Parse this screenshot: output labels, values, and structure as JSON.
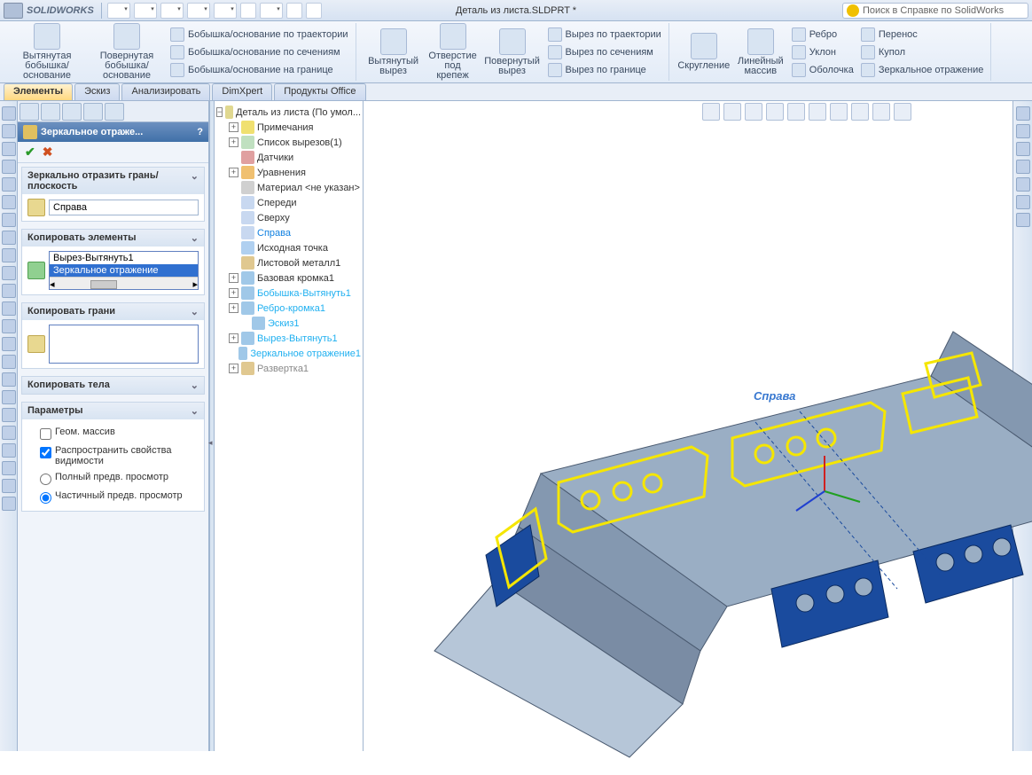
{
  "app": {
    "name": "SOLIDWORKS",
    "doc_title": "Деталь из листа.SLDPRT *"
  },
  "search": {
    "placeholder": "Поиск в Справке по SolidWorks"
  },
  "ribbon": {
    "extruded_boss": "Вытянутая\nбобышка/основание",
    "revolved_boss": "Повернутая\nбобышка/основание",
    "swept_boss": "Бобышка/основание по траектории",
    "lofted_boss": "Бобышка/основание по сечениям",
    "boundary_boss": "Бобышка/основание на границе",
    "extruded_cut": "Вытянутый\nвырез",
    "hole_wizard": "Отверстие\nпод\nкрепеж",
    "revolved_cut": "Повернутый\nвырез",
    "swept_cut": "Вырез по траектории",
    "lofted_cut": "Вырез по сечениям",
    "boundary_cut": "Вырез по границе",
    "fillet": "Скругление",
    "linear_pattern": "Линейный\nмассив",
    "rib": "Ребро",
    "draft": "Уклон",
    "shell": "Оболочка",
    "wrap": "Перенос",
    "dome": "Купол",
    "mirror": "Зеркальное отражение"
  },
  "tabs": {
    "features": "Элементы",
    "sketch": "Эскиз",
    "evaluate": "Анализировать",
    "dimxpert": "DimXpert",
    "office": "Продукты Office"
  },
  "pm": {
    "title": "Зеркальное отраже...",
    "group_mirror": "Зеркально отразить грань/плоскость",
    "mirror_value": "Справа",
    "group_copy_elem": "Копировать элементы",
    "copy_item1": "Вырез-Вытянуть1",
    "copy_item2": "Зеркальное отражение",
    "group_copy_faces": "Копировать грани",
    "group_copy_bodies": "Копировать тела",
    "group_params": "Параметры",
    "geom_pattern": "Геом. массив",
    "propagate": "Распространить свойства видимости",
    "full_preview": "Полный предв. просмотр",
    "partial_preview": "Частичный предв. просмотр"
  },
  "tree": {
    "root": "Деталь из листа  (По умол...",
    "annotations": "Примечания",
    "cutlist": "Список вырезов(1)",
    "sensors": "Датчики",
    "equations": "Уравнения",
    "material": "Материал <не указан>",
    "front": "Спереди",
    "top": "Сверху",
    "right": "Справа",
    "origin": "Исходная точка",
    "sheetmetal": "Листовой металл1",
    "baseflange": "Базовая кромка1",
    "boss_extrude": "Бобышка-Вытянуть1",
    "edge_flange": "Ребро-кромка1",
    "sketch1": "Эскиз1",
    "cut_extrude": "Вырез-Вытянуть1",
    "mirror1": "Зеркальное отражение1",
    "flatpattern": "Развертка1"
  },
  "viewport": {
    "plane_label": "Справа"
  }
}
